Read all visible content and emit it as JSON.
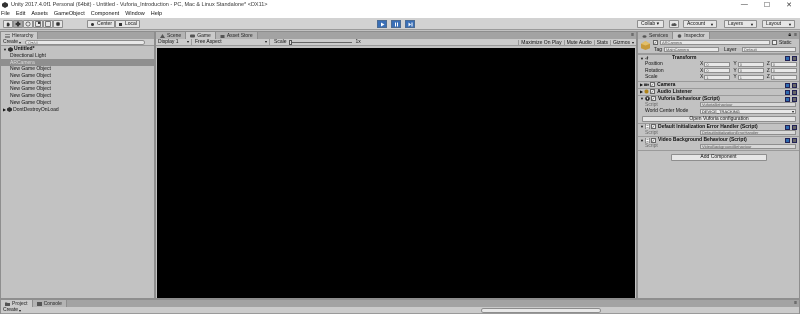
{
  "window": {
    "title": "Unity 2017.4.0f1 Personal (64bit) - Untitled - Vuforia_Introduction - PC, Mac & Linux Standalone* <DX11>",
    "controls": [
      "—",
      "☐",
      "✕"
    ]
  },
  "menu": [
    "File",
    "Edit",
    "Assets",
    "GameObject",
    "Component",
    "Window",
    "Help"
  ],
  "toolbar": {
    "center_label": "Center",
    "local_label": "Local",
    "collab_label": "Collab ▾",
    "account_label": "Account",
    "layers_label": "Layers",
    "layout_label": "Layout"
  },
  "hierarchy": {
    "tab_label": "Hierarchy",
    "create_label": "Create",
    "search_placeholder": "Q▾All",
    "scene_name": "Untitled*",
    "items": [
      "Directional Light",
      "ARCamera",
      "New Game Object",
      "New Game Object",
      "New Game Object",
      "New Game Object",
      "New Game Object",
      "New Game Object"
    ],
    "dont_destroy": "DontDestroyOnLoad"
  },
  "views": {
    "tabs": [
      "Scene",
      "Game",
      "Asset Store"
    ],
    "display": "Display 1",
    "aspect": "Free Aspect",
    "scale_label": "Scale",
    "scale_value": "1x",
    "maximize": "Maximize On Play",
    "mute": "Mute Audio",
    "stats": "Stats",
    "gizmos": "Gizmos"
  },
  "inspector": {
    "services_tab": "Services",
    "inspector_tab": "Inspector",
    "object_name": "ARCamera",
    "static_label": "Static",
    "tag_label": "Tag",
    "tag_value": "MainCamera",
    "layer_label": "Layer",
    "layer_value": "Default",
    "transform": {
      "title": "Transform",
      "rows": [
        {
          "label": "Position",
          "x": "0",
          "y": "0",
          "z": "0"
        },
        {
          "label": "Rotation",
          "x": "0",
          "y": "0",
          "z": "0"
        },
        {
          "label": "Scale",
          "x": "1",
          "y": "1",
          "z": "1"
        }
      ]
    },
    "camera_title": "Camera",
    "audio_listener_title": "Audio Listener",
    "vuforia": {
      "title": "Vuforia Behaviour (Script)",
      "script_label": "Script",
      "script_value": "VuforiaBehaviour",
      "world_center_label": "World Center Mode",
      "world_center_value": "DEVICE_TRACKING",
      "config_button": "Open Vuforia configuration"
    },
    "error_handler": {
      "title": "Default Initialization Error Handler (Script)",
      "script_label": "Script",
      "script_value": "DefaultInitializationErrorHandler"
    },
    "video_bg": {
      "title": "Video Background Behaviour (Script)",
      "script_label": "Script",
      "script_value": "VideoBackgroundBehaviour"
    },
    "add_component": "Add Component"
  },
  "bottom": {
    "project_tab": "Project",
    "console_tab": "Console",
    "create_label": "Create"
  },
  "colors": {
    "play_blue": "#3a6fb7",
    "game_bg": "#000000",
    "panel_bg": "#c2c2c2"
  }
}
